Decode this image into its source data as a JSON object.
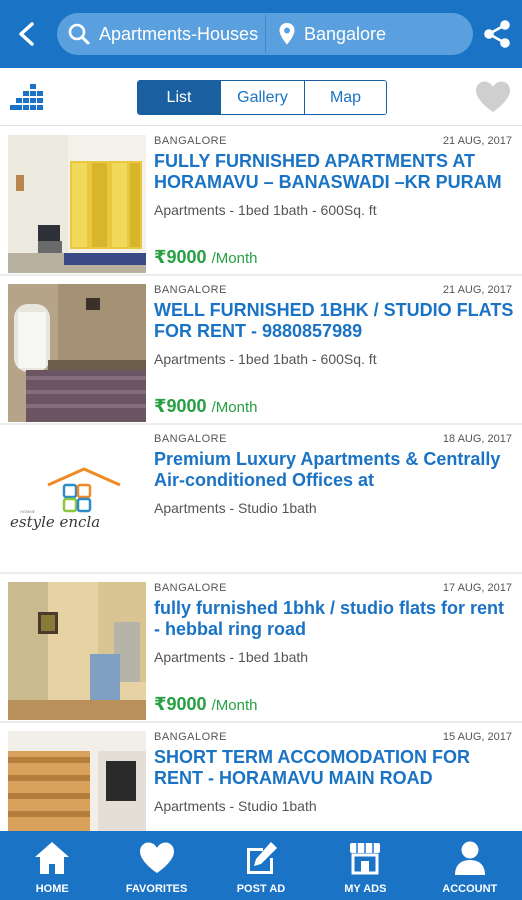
{
  "header": {
    "back_icon": "arrow-left-icon",
    "search_text": "Apartments-Houses",
    "search_icon": "search-icon",
    "location_text": "Bangalore",
    "location_icon": "map-pin-icon",
    "share_icon": "share-icon",
    "brand_color": "#1a73c4"
  },
  "toolbar": {
    "grid_icon": "category-grid-icon",
    "tabs": [
      {
        "label": "List",
        "active": true
      },
      {
        "label": "Gallery",
        "active": false
      },
      {
        "label": "Map",
        "active": false
      }
    ],
    "favorite_icon": "heart-icon"
  },
  "listings": [
    {
      "city": "BANGALORE",
      "date": "21 AUG, 2017",
      "title": "FULLY FURNISHED APARTMENTS AT HORAMAVU – BANASWADI –KR PURAM",
      "meta": "Apartments - 1bed 1bath - 600Sq. ft",
      "price": "₹9000",
      "per": "/Month"
    },
    {
      "city": "BANGALORE",
      "date": "21 AUG, 2017",
      "title": "WELL FURNISHED 1BHK / STUDIO FLATS FOR RENT - 9880857989",
      "meta": "Apartments - 1bed 1bath - 600Sq. ft",
      "price": "₹9000",
      "per": "/Month"
    },
    {
      "city": "BANGALORE",
      "date": "18 AUG, 2017",
      "title": "Premium Luxury Apartments & Centrally Air-conditioned Offices at",
      "meta": "Apartments - Studio 1bath",
      "price": "",
      "per": "",
      "logo_text": "estyle encla",
      "logo_small": "HOMME"
    },
    {
      "city": "BANGALORE",
      "date": "17 AUG, 2017",
      "title": "fully furnished 1bhk / studio flats for rent - hebbal ring road",
      "meta": "Apartments - 1bed 1bath",
      "price": "₹9000",
      "per": "/Month"
    },
    {
      "city": "BANGALORE",
      "date": "15 AUG, 2017",
      "title": "SHORT TERM ACCOMODATION FOR RENT - HORAMAVU MAIN ROAD",
      "meta": "Apartments - Studio 1bath",
      "price": "",
      "per": ""
    }
  ],
  "bottom_nav": [
    {
      "label": "HOME",
      "icon": "home-icon"
    },
    {
      "label": "FAVORITES",
      "icon": "heart-icon"
    },
    {
      "label": "POST AD",
      "icon": "edit-icon"
    },
    {
      "label": "MY ADS",
      "icon": "store-icon"
    },
    {
      "label": "ACCOUNT",
      "icon": "user-icon"
    }
  ]
}
